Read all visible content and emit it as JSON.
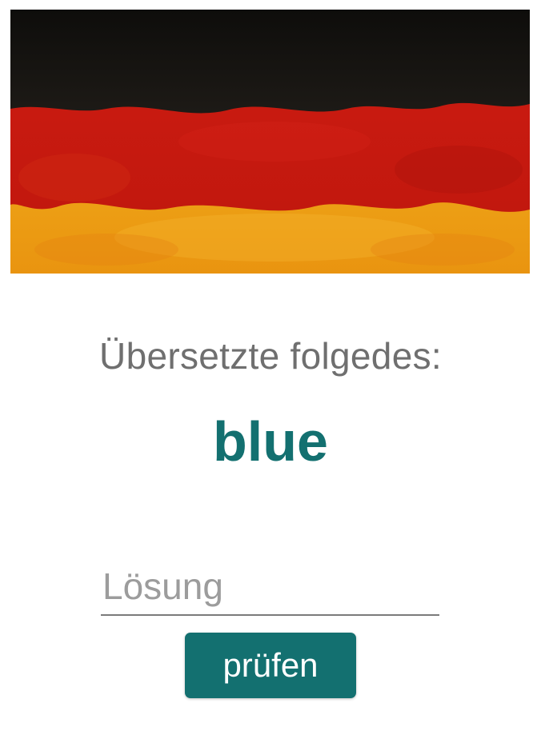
{
  "header_image": {
    "icon": "german-flag-image",
    "colors": {
      "black": "#141210",
      "red": "#c0160f",
      "gold": "#efa514"
    }
  },
  "quiz": {
    "prompt": "Übersetzte folgedes:",
    "word": "blue"
  },
  "answer_input": {
    "value": "",
    "placeholder": "Lösung"
  },
  "check_button": {
    "label": "prüfen"
  },
  "colors": {
    "accent": "#137070",
    "prompt_text": "#6f6f6f",
    "placeholder": "#9c9c9c"
  }
}
